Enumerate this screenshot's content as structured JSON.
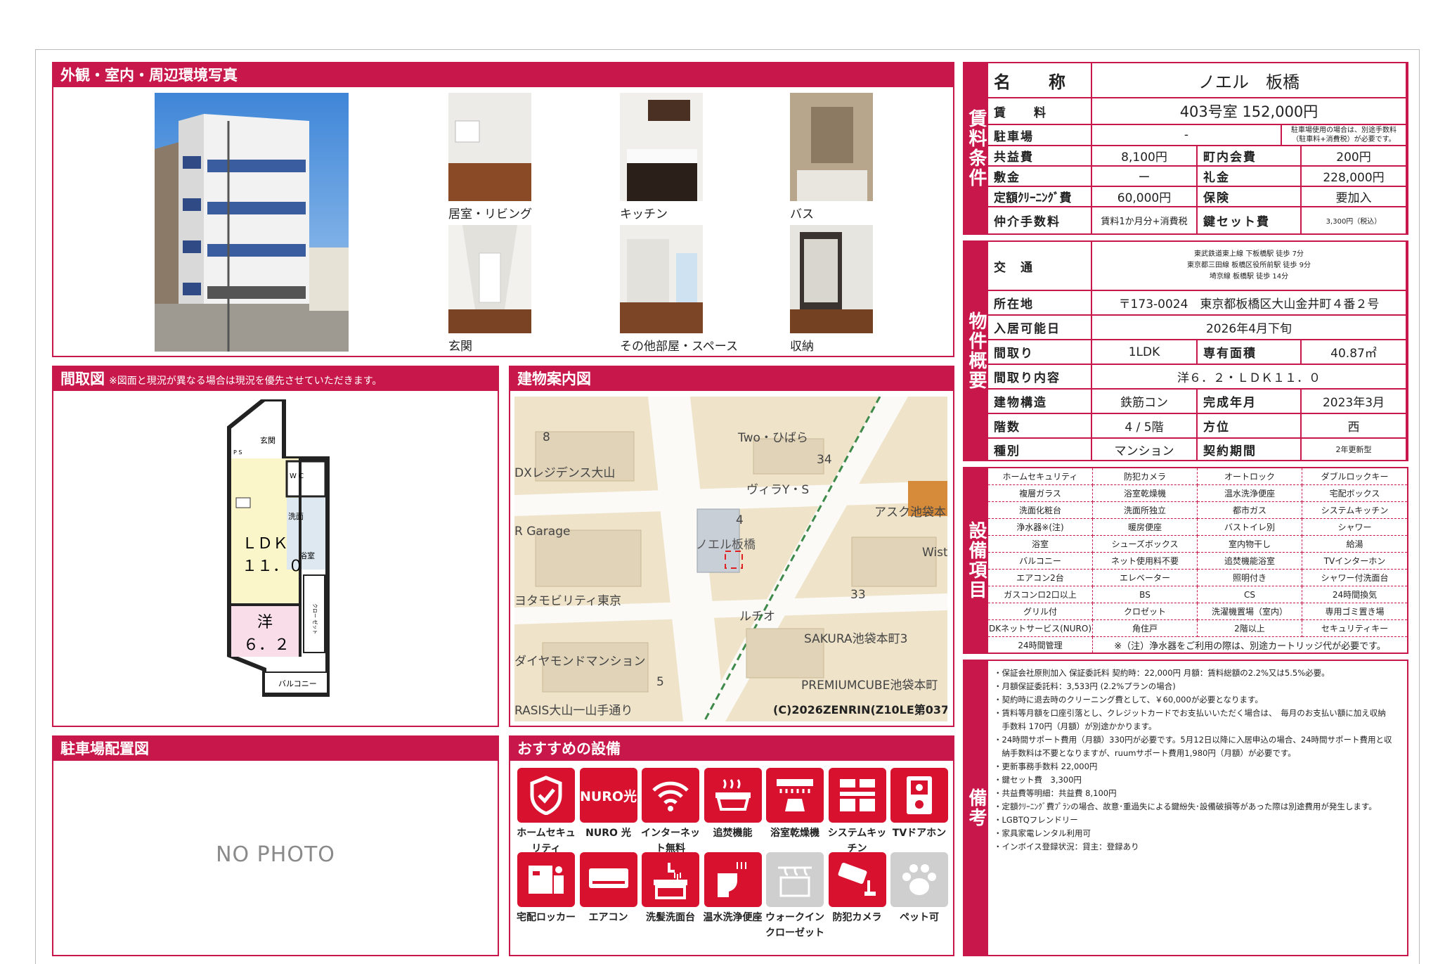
{
  "photos": {
    "title": "外観・室内・周辺環境写真",
    "items": [
      {
        "label": "居室・リビング"
      },
      {
        "label": "キッチン"
      },
      {
        "label": "バス"
      },
      {
        "label": "玄関"
      },
      {
        "label": "その他部屋・スペース"
      },
      {
        "label": "収納"
      }
    ]
  },
  "floorplan": {
    "title": "間取図",
    "note": "※図面と現況が異なる場合は現況を優先させていただきます。",
    "rooms": {
      "genkan": "玄関",
      "wc": "W C",
      "sen": "洗面",
      "bath": "浴室",
      "ldk": "ＬＤＫ",
      "ldk_size": "１１．０",
      "yo": "洋",
      "yo_size": "６．２",
      "closet": "クロー ゼット",
      "balcony": "バルコニー",
      "ps": "P S"
    }
  },
  "map": {
    "title": "建物案内図",
    "labels": [
      "Two・ひばら",
      "34",
      "ヴィラY・S",
      "DXレジデンス大山",
      "R Garage",
      "4",
      "ノエル板橋",
      "アスク池袋本",
      "Wist",
      "ヨタモビリティ東京",
      "33",
      "ルチオ",
      "SAKURA池袋本町3",
      "ダイヤモンドマンション",
      "5",
      "PREMIUMCUBE池袋本町",
      "RASIS大山一山手通り",
      "8"
    ],
    "copyright": "(C)2026ZENRIN(Z10LE第037号)"
  },
  "parking": {
    "title": "駐車場配置図",
    "no_photo": "NO PHOTO"
  },
  "recommend": {
    "title": "おすすめの設備",
    "items": [
      {
        "label": "ホームセキュリティ",
        "icon": "shield-icon",
        "on": true
      },
      {
        "label": "NURO 光",
        "icon": "nuro-icon",
        "on": true,
        "tile_text": "NURO光"
      },
      {
        "label": "インターネット無料",
        "icon": "wifi-icon",
        "on": true
      },
      {
        "label": "追焚機能",
        "icon": "bathtub-icon",
        "on": true
      },
      {
        "label": "浴室乾燥機",
        "icon": "bath-dryer-icon",
        "on": true
      },
      {
        "label": "システムキッチン",
        "icon": "kitchen-icon",
        "on": true
      },
      {
        "label": "TVドアホン",
        "icon": "intercom-icon",
        "on": true
      },
      {
        "label": "宅配ロッカー",
        "icon": "delivery-locker-icon",
        "on": true
      },
      {
        "label": "エアコン",
        "icon": "air-conditioner-icon",
        "on": true
      },
      {
        "label": "洗髪洗面台",
        "icon": "washbasin-icon",
        "on": true
      },
      {
        "label": "温水洗浄便座",
        "icon": "toilet-icon",
        "on": true
      },
      {
        "label": "ウォークインクローゼット",
        "icon": "closet-icon",
        "on": false
      },
      {
        "label": "防犯カメラ",
        "icon": "camera-icon",
        "on": true
      },
      {
        "label": "ペット可",
        "icon": "paw-icon",
        "on": false
      }
    ]
  },
  "rent": {
    "side": "賃料条件",
    "name_label": "名　　称",
    "name": "ノエル　板橋",
    "rent_label": "賃　　料",
    "rent": "403号室 152,000円",
    "parking_label": "駐車場",
    "parking": "-",
    "parking_note": "駐車場使用の場合は、別途手数料（駐車料+消費税）が必要です。",
    "common_label": "共益費",
    "common": "8,100円",
    "town_label": "町内会費",
    "town": "200円",
    "deposit_label": "敷金",
    "deposit": "ー",
    "key_money_label": "礼金",
    "key_money": "228,000円",
    "cleaning_label": "定額ｸﾘｰﾆﾝｸﾞ費",
    "cleaning": "60,000円",
    "insurance_label": "保険",
    "insurance": "要加入",
    "broker_label": "仲介手数料",
    "broker": "賃料1か月分+消費税",
    "keyset_label": "鍵セット費",
    "keyset": "3,300円（税込）"
  },
  "property": {
    "side": "物件概要",
    "traffic_label": "交　通",
    "traffic": [
      "東武鉄道東上線 下板橋駅 徒歩 7分",
      "東京都三田線 板橋区役所前駅 徒歩 9分",
      "埼京線 板橋駅 徒歩 14分"
    ],
    "address_label": "所在地",
    "address": "〒173-0024　東京都板橋区大山金井町４番２号",
    "movein_label": "入居可能日",
    "movein": "2026年4月下旬",
    "layout_label": "間取り",
    "layout": "1LDK",
    "area_label": "専有面積",
    "area": "40.87㎡",
    "detail_label": "間取り内容",
    "detail": "洋６．２・ＬＤＫ１１．０",
    "structure_label": "建物構造",
    "structure": "鉄筋コン",
    "built_label": "完成年月",
    "built": "2023年3月",
    "floor_label": "階数",
    "floor": "4 / 5階",
    "direction_label": "方位",
    "direction": "西",
    "type_label": "種別",
    "type": "マンション",
    "contract_label": "契約期間",
    "contract": "2年更新型"
  },
  "equipment": {
    "side": "設備項目",
    "rows": [
      [
        "ホームセキュリティ",
        "防犯カメラ",
        "オートロック",
        "ダブルロックキー"
      ],
      [
        "複層ガラス",
        "浴室乾燥機",
        "温水洗浄便座",
        "宅配ボックス"
      ],
      [
        "洗面化粧台",
        "洗面所独立",
        "都市ガス",
        "システムキッチン"
      ],
      [
        "浄水器※(注)",
        "暖房便座",
        "バストイレ別",
        "シャワー"
      ],
      [
        "浴室",
        "シューズボックス",
        "室内物干し",
        "給湯"
      ],
      [
        "バルコニー",
        "ネット使用料不要",
        "追焚機能浴室",
        "TVインターホン"
      ],
      [
        "エアコン2台",
        "エレベーター",
        "照明付き",
        "シャワー付洗面台"
      ],
      [
        "ガスコンロ2口以上",
        "BS",
        "CS",
        "24時間換気"
      ],
      [
        "グリル付",
        "クロゼット",
        "洗濯機置場（室内）",
        "専用ゴミ置き場"
      ],
      [
        "DKネットサービス(NURO)",
        "角住戸",
        "2階以上",
        "セキュリティキー"
      ]
    ],
    "last_left": "24時間管理",
    "last_note": "※（注）浄水器をご利用の際は、別途カートリッジ代が必要です。"
  },
  "remarks": {
    "side": "備考",
    "lines": [
      "・保証会社原則加入 保証委託料 契約時：22,000円 月額：賃料総額の2.2%又は5.5%必要。",
      "・月額保証委託料：3,533円 (2.2%プランの場合)",
      "・契約時に退去時のクリーニング費として、￥60,000が必要となります。",
      "・賃料等月額を口座引落とし、クレジットカードでお支払いいただく場合は、　毎月のお支払い額に加え収納",
      "　手数料 170円（月額）が別途かかります。",
      "・24時間サポート費用（月額）330円が必要です。5月12日以降に入居申込の場合、24時間サポート費用と収",
      "　納手数料は不要となりますが、ruumサポート費用1,980円（月額）が必要です。",
      "・更新事務手数料 22,000円",
      "・鍵セット費　3,300円",
      "・共益費等明細：共益費 8,100円",
      "・定額ｸﾘｰﾆﾝｸﾞ費ﾌﾟﾗﾝの場合、故意･重過失による鍵紛失･設備破損等があった際は別途費用が発生します。",
      "・LGBTQフレンドリー",
      "・家具家電レンタル利用可",
      "・インボイス登録状況：貸主：登録あり"
    ]
  }
}
